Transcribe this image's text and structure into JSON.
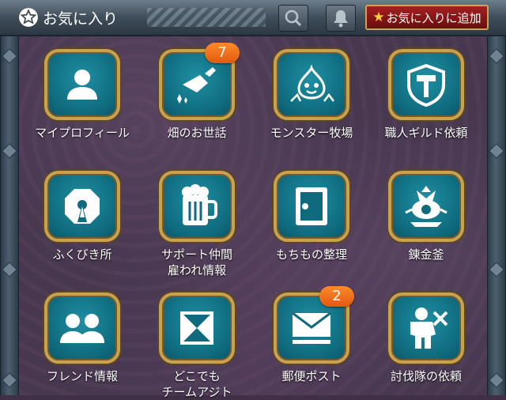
{
  "header": {
    "title": "お気に入り",
    "search_icon": "search-icon",
    "bell_icon": "bell-icon",
    "add_favorite_label": "お気に入りに追加",
    "add_favorite_icon": "star-icon"
  },
  "tiles": [
    {
      "label": "マイプロフィール",
      "icon": "person-icon"
    },
    {
      "label": "畑のお世話",
      "icon": "watering-can-icon",
      "badge": "7"
    },
    {
      "label": "モンスター牧場",
      "icon": "slime-icon"
    },
    {
      "label": "職人ギルド依頼",
      "icon": "hammer-shield-icon"
    },
    {
      "label": "ふくびき所",
      "icon": "lottery-icon"
    },
    {
      "label1": "サポート仲間",
      "label2": "雇われ情報",
      "icon": "beer-mug-icon"
    },
    {
      "label": "もちもの整理",
      "icon": "safe-icon"
    },
    {
      "label": "錬金釜",
      "icon": "alchemy-pot-icon"
    },
    {
      "label": "フレンド情報",
      "icon": "friends-icon"
    },
    {
      "label1": "どこでも",
      "label2": "チームアジト",
      "icon": "hourglass-icon"
    },
    {
      "label": "郵便ポスト",
      "icon": "mail-icon",
      "badge": "2"
    },
    {
      "label": "討伐隊の依頼",
      "icon": "warrior-icon"
    }
  ]
}
